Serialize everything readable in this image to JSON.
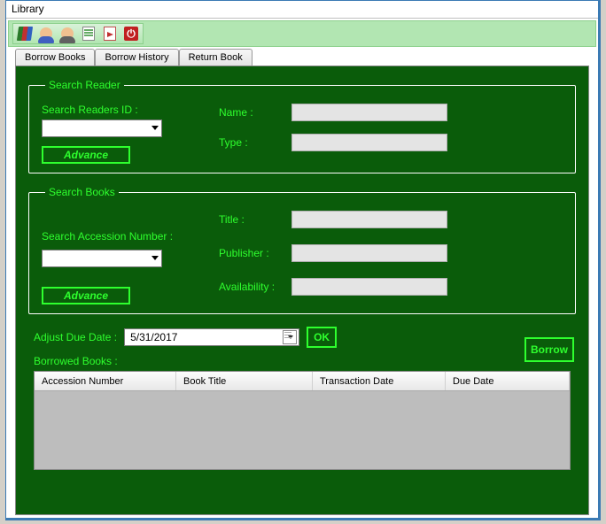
{
  "window": {
    "title": "Library"
  },
  "toolbar": {
    "icons": [
      "books-icon",
      "reader-icon",
      "staff-icon",
      "report-icon",
      "exit-icon",
      "power-icon"
    ]
  },
  "tabs": {
    "borrow": "Borrow Books",
    "history": "Borrow History",
    "return": "Return Book"
  },
  "searchReader": {
    "legend": "Search Reader",
    "idLabel": "Search Readers ID :",
    "advance": "Advance",
    "nameLabel": "Name :",
    "typeLabel": "Type :"
  },
  "searchBooks": {
    "legend": "Search Books",
    "accLabel": "Search Accession Number :",
    "advance": "Advance",
    "titleLabel": "Title   :",
    "publisherLabel": "Publisher :",
    "availLabel": "Availability :"
  },
  "borrowButton": "Borrow",
  "adjust": {
    "label": "Adjust Due Date :",
    "date": "5/31/2017",
    "ok": "OK"
  },
  "borrowed": {
    "label": "Borrowed Books :",
    "columns": {
      "accession": "Accession Number",
      "title": "Book Title",
      "txn": "Transaction Date",
      "due": "Due Date"
    }
  }
}
